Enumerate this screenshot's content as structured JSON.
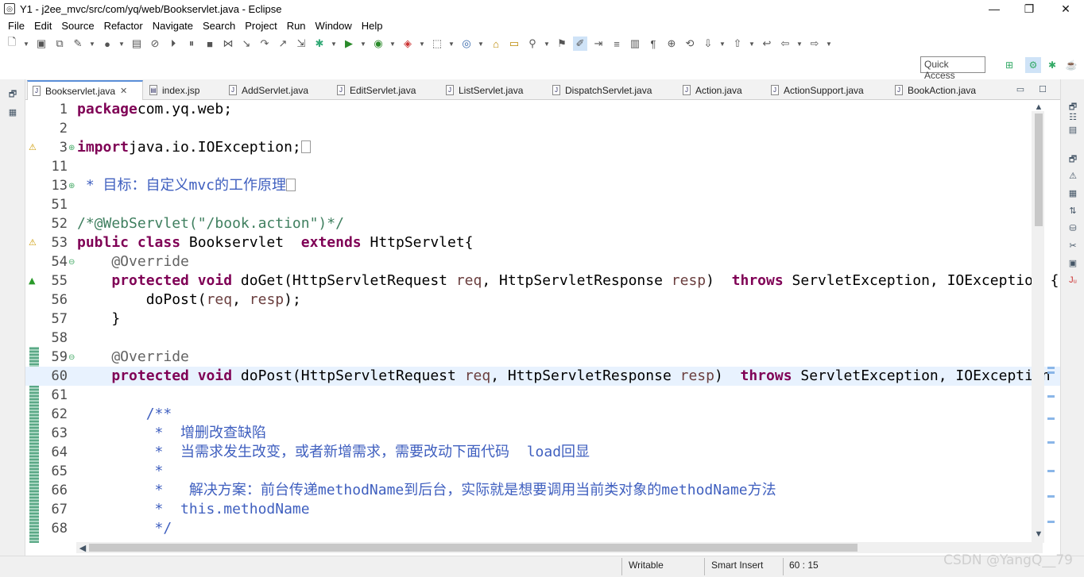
{
  "window": {
    "title": "Y1 - j2ee_mvc/src/com/yq/web/Bookservlet.java - Eclipse",
    "minimize": "—",
    "maximize": "❐",
    "close": "✕"
  },
  "menu": [
    "File",
    "Edit",
    "Source",
    "Refactor",
    "Navigate",
    "Search",
    "Project",
    "Run",
    "Window",
    "Help"
  ],
  "quick_access": "Quick Access",
  "tabs": [
    {
      "label": "Bookservlet.java",
      "active": true
    },
    {
      "label": "index.jsp"
    },
    {
      "label": "AddServlet.java"
    },
    {
      "label": "EditServlet.java"
    },
    {
      "label": "ListServlet.java"
    },
    {
      "label": "DispatchServlet.java"
    },
    {
      "label": "Action.java"
    },
    {
      "label": "ActionSupport.java"
    },
    {
      "label": "BookAction.java"
    }
  ],
  "code_lines": [
    {
      "n": "1",
      "parts": [
        [
          "kw",
          "package"
        ],
        [
          "",
          "com.yq.web;"
        ]
      ]
    },
    {
      "n": "2",
      "parts": []
    },
    {
      "n": "3",
      "fold": "⊕",
      "marker": "warn",
      "parts": [
        [
          "kw",
          "import"
        ],
        [
          "",
          "java.io.IOException;"
        ]
      ],
      "box": true
    },
    {
      "n": "11",
      "parts": []
    },
    {
      "n": "13",
      "fold": "⊕",
      "parts": [
        [
          "jd",
          " * 目标：自定义mvc的工作原理"
        ]
      ],
      "box": true
    },
    {
      "n": "51",
      "parts": []
    },
    {
      "n": "52",
      "parts": [
        [
          "cmt",
          "/*@WebServlet(\"/book.action\")*/"
        ]
      ]
    },
    {
      "n": "53",
      "marker": "warn",
      "parts": [
        [
          "kw",
          "public class"
        ],
        [
          "",
          " Bookservlet "
        ],
        [
          "kw",
          "extends"
        ],
        [
          "",
          " HttpServlet{"
        ]
      ]
    },
    {
      "n": "54",
      "fold": "⊖",
      "parts": [
        [
          "ann",
          "    @Override"
        ]
      ]
    },
    {
      "n": "55",
      "marker": "up",
      "parts": [
        [
          "kw",
          "    protected void"
        ],
        [
          "",
          " doGet(HttpServletRequest "
        ],
        [
          "var",
          "req"
        ],
        [
          "",
          ", HttpServletResponse "
        ],
        [
          "var",
          "resp"
        ],
        [
          "",
          ") "
        ],
        [
          "kw",
          "throws"
        ],
        [
          "",
          " ServletException, IOException {"
        ]
      ]
    },
    {
      "n": "56",
      "parts": [
        [
          "",
          "        doPost("
        ],
        [
          "var",
          "req"
        ],
        [
          "",
          ", "
        ],
        [
          "var",
          "resp"
        ],
        [
          "",
          ");"
        ]
      ]
    },
    {
      "n": "57",
      "parts": [
        [
          "",
          "    }"
        ]
      ]
    },
    {
      "n": "58",
      "parts": []
    },
    {
      "n": "59",
      "fold": "⊖",
      "parts": [
        [
          "ann",
          "    @Override"
        ]
      ]
    },
    {
      "n": "60",
      "cur": true,
      "parts": [
        [
          "kw",
          "    protected void"
        ],
        [
          "",
          " doPost(HttpServletRequest "
        ],
        [
          "var",
          "req"
        ],
        [
          "",
          ", HttpServletResponse "
        ],
        [
          "var",
          "resp"
        ],
        [
          "",
          ") "
        ],
        [
          "kw",
          "throws"
        ],
        [
          "",
          " ServletException, IOException {"
        ]
      ]
    },
    {
      "n": "61",
      "parts": []
    },
    {
      "n": "62",
      "parts": [
        [
          "jd",
          "        /**"
        ]
      ]
    },
    {
      "n": "63",
      "parts": [
        [
          "jd",
          "         *  增删改查缺陷"
        ]
      ]
    },
    {
      "n": "64",
      "parts": [
        [
          "jd",
          "         *  当需求发生改变，或者新增需求，需要改动下面代码  load回显"
        ]
      ]
    },
    {
      "n": "65",
      "parts": [
        [
          "jd",
          "         *"
        ]
      ]
    },
    {
      "n": "66",
      "parts": [
        [
          "jd",
          "         *   解决方案：前台传递methodName到后台，实际就是想要调用当前类对象的methodName方法"
        ]
      ]
    },
    {
      "n": "67",
      "parts": [
        [
          "jd",
          "         *  this.methodName"
        ]
      ]
    },
    {
      "n": "68",
      "parts": [
        [
          "jd",
          "         */"
        ]
      ]
    }
  ],
  "status": {
    "writable": "Writable",
    "insert_mode": "Smart Insert",
    "position": "60 : 15"
  },
  "watermark": "CSDN @YangQ__79"
}
